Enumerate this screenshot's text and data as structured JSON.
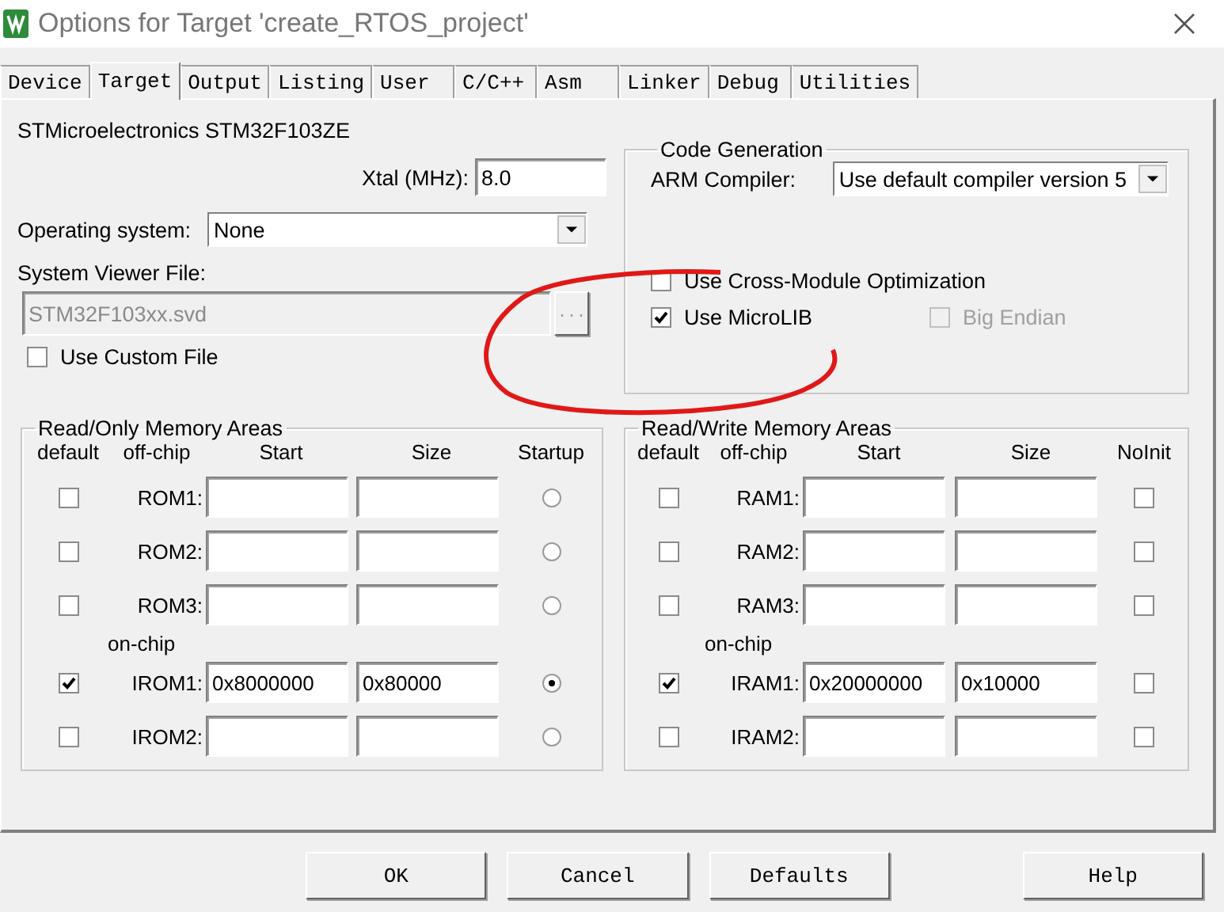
{
  "window": {
    "title": "Options for Target 'create_RTOS_project'"
  },
  "tabs": [
    {
      "label": "Device",
      "selected": false
    },
    {
      "label": "Target",
      "selected": true
    },
    {
      "label": "Output",
      "selected": false
    },
    {
      "label": "Listing",
      "selected": false
    },
    {
      "label": "User",
      "selected": false
    },
    {
      "label": "C/C++",
      "selected": false
    },
    {
      "label": "Asm",
      "selected": false
    },
    {
      "label": "Linker",
      "selected": false
    },
    {
      "label": "Debug",
      "selected": false
    },
    {
      "label": "Utilities",
      "selected": false
    }
  ],
  "device": "STMicroelectronics STM32F103ZE",
  "xtal": {
    "label": "Xtal (MHz):",
    "value": "8.0"
  },
  "operating_system": {
    "label": "Operating system:",
    "value": "None"
  },
  "system_viewer": {
    "label": "System Viewer File:",
    "value": "STM32F103xx.svd",
    "disabled": true,
    "browse": "..."
  },
  "use_custom_file": {
    "label": "Use Custom File",
    "checked": false
  },
  "code_generation": {
    "title": "Code Generation",
    "compiler_label": "ARM Compiler:",
    "compiler": "Use default compiler version 5",
    "options": [
      {
        "label": "Use Cross-Module Optimization",
        "checked": false,
        "disabled": false
      },
      {
        "label": "Use MicroLIB",
        "checked": true,
        "disabled": false
      },
      {
        "label": "Big Endian",
        "checked": false,
        "disabled": true
      }
    ]
  },
  "rom": {
    "title": "Read/Only Memory Areas",
    "columns": [
      "default",
      "off-chip",
      "Start",
      "Size",
      "Startup"
    ],
    "on_chip_label": "on-chip",
    "off_chip_rows": [
      {
        "name": "ROM1:",
        "default": false,
        "selected": false
      },
      {
        "name": "ROM2:",
        "default": false,
        "selected": false
      },
      {
        "name": "ROM3:",
        "default": false,
        "selected": false
      }
    ],
    "on_chip_rows": [
      {
        "name": "IROM1:",
        "default": true,
        "start": "0x8000000",
        "size": "0x80000",
        "selected": true
      },
      {
        "name": "IROM2:",
        "default": false,
        "selected": false
      }
    ]
  },
  "ram": {
    "title": "Read/Write Memory Areas",
    "columns": [
      "default",
      "off-chip",
      "Start",
      "Size",
      "NoInit"
    ],
    "on_chip_label": "on-chip",
    "off_chip_rows": [
      {
        "name": "RAM1:",
        "default": false,
        "no_init": false
      },
      {
        "name": "RAM2:",
        "default": false,
        "no_init": false
      },
      {
        "name": "RAM3:",
        "default": false,
        "no_init": false
      }
    ],
    "on_chip_rows": [
      {
        "name": "IRAM1:",
        "default": true,
        "start": "0x20000000",
        "size": "0x10000",
        "no_init": false
      },
      {
        "name": "IRAM2:",
        "default": false,
        "no_init": false
      }
    ]
  },
  "buttons": [
    "OK",
    "Cancel",
    "Defaults",
    "Help"
  ]
}
